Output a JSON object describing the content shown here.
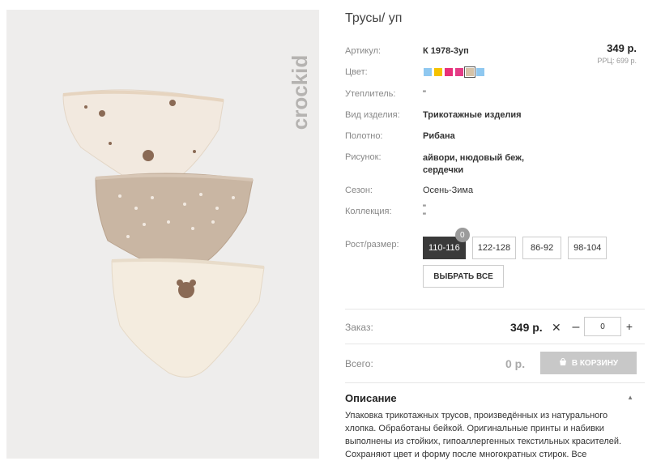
{
  "product": {
    "brand_logo": "crockid",
    "title": "Трусы/ уп",
    "price": "349 р.",
    "rrp": "РРЦ: 699 р."
  },
  "attributes": [
    {
      "label": "Артикул:",
      "value": "К 1978-3уп"
    },
    {
      "label": "Цвет:",
      "value": ""
    },
    {
      "label": "Утеплитель:",
      "value": "\""
    },
    {
      "label": "Вид изделия:",
      "value": "Трикотажные изделия"
    },
    {
      "label": "Полотно:",
      "value": "Рибана"
    },
    {
      "label": "Рисунок:",
      "value": "айвори, нюдовый беж, сердечки"
    },
    {
      "label": "Сезон:",
      "value": "Осень-Зима"
    },
    {
      "label": "Коллекция:",
      "value": "\"\n\""
    }
  ],
  "colors": [
    "#8fc8f0",
    "#f5c200",
    "#e8307a",
    "#e43c86",
    "#d6c3a8",
    "#8fc8f0"
  ],
  "size": {
    "label": "Рост/размер:",
    "options": [
      "110-116",
      "122-128",
      "86-92",
      "98-104"
    ],
    "badge": "0",
    "select_all": "ВЫБРАТЬ ВСЕ"
  },
  "order": {
    "label": "Заказ:",
    "price": "349 р.",
    "times": "✕",
    "minus": "–",
    "qty": "0",
    "plus": "+"
  },
  "total": {
    "label": "Всего:",
    "value": "0 р.",
    "cart_label": "В КОРЗИНУ"
  },
  "description": {
    "heading": "Описание",
    "arrow": "▲",
    "text": "Упаковка трикотажных трусов, произведённых из натурального хлопка. Обработаны бейкой. Оригинальные принты и набивки выполнены из стойких, гипоаллергенных текстильных красителей. Сохраняют цвет и форму после многократных стирок. Все"
  }
}
